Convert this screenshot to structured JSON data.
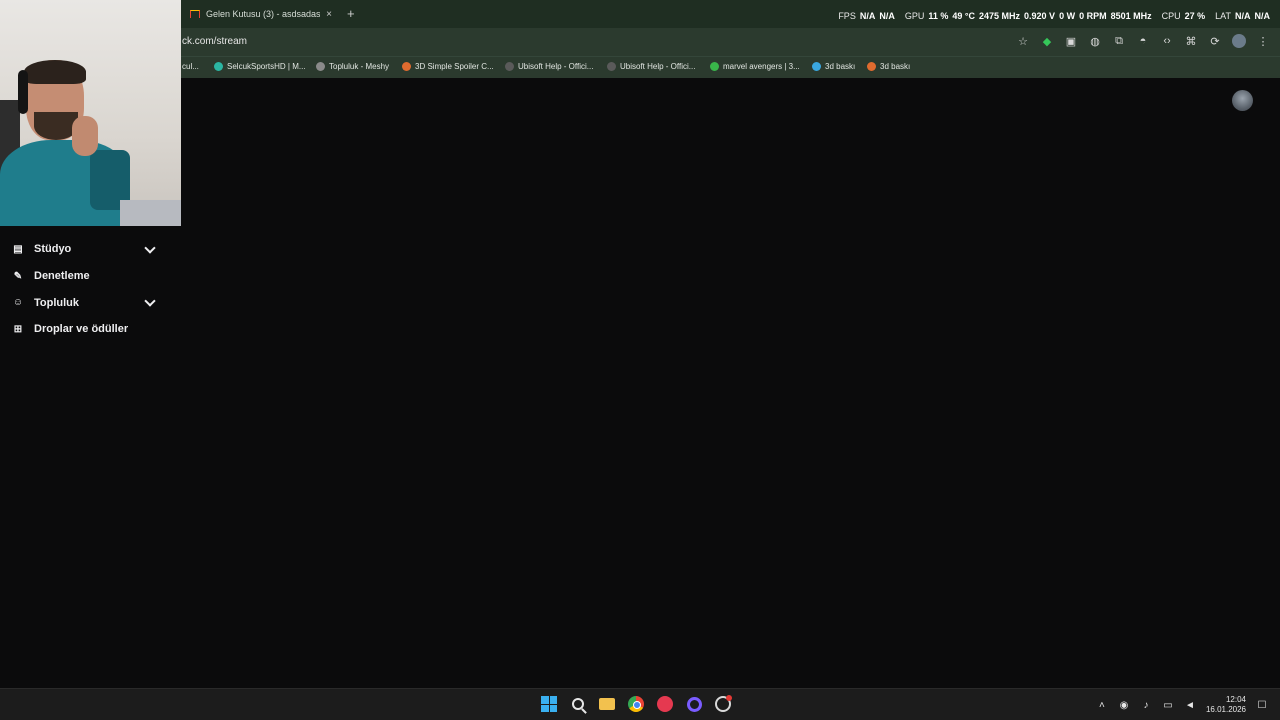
{
  "browser": {
    "tab_title": "Gelen Kutusu (3) - asdsadasdas",
    "tab_close": "×",
    "new_tab": "+",
    "url": "ck.com/stream",
    "bookmarks": [
      {
        "label": "cul...",
        "color": "#6b7b6b"
      },
      {
        "label": "SelcukSportsHD | M...",
        "color": "#2bb5a2"
      },
      {
        "label": "Topluluk - Meshy",
        "color": "#8a8a8a"
      },
      {
        "label": "3D Simple Spoiler C...",
        "color": "#e06b2f"
      },
      {
        "label": "Ubisoft Help - Offici...",
        "color": "#5a5a5a"
      },
      {
        "label": "Ubisoft Help - Offici...",
        "color": "#5a5a5a"
      },
      {
        "label": "marvel avengers | 3...",
        "color": "#39b54a"
      },
      {
        "label": "3d baskı",
        "color": "#3aa7e0"
      },
      {
        "label": "3d baskı",
        "color": "#e06b2f"
      }
    ]
  },
  "overlay": {
    "fps_label": "FPS",
    "fps_val1": "N/A",
    "fps_val2": "N/A",
    "gpu_label": "GPU",
    "gpu_usage": "11 %",
    "gpu_temp": "49 °C",
    "gpu_clock": "2475 MHz",
    "gpu_voltage": "0.920 V",
    "gpu_power": "0 W",
    "gpu_fan": "0 RPM",
    "gpu_mem": "8501 MHz",
    "cpu_label": "CPU",
    "cpu_usage": "27 %",
    "lat_label": "LAT",
    "lat_val1": "N/A",
    "lat_val2": "N/A"
  },
  "sidebar": {
    "items": [
      {
        "label": "Stüdyo",
        "icon": "studio-icon",
        "expandable": true
      },
      {
        "label": "Denetleme",
        "icon": "wrench-icon",
        "expandable": false
      },
      {
        "label": "Topluluk",
        "icon": "community-icon",
        "expandable": true
      },
      {
        "label": "Droplar ve ödüller",
        "icon": "drops-icon",
        "expandable": false
      }
    ]
  },
  "taskbar": {
    "time": "12:04",
    "date": "16.01.2026"
  }
}
